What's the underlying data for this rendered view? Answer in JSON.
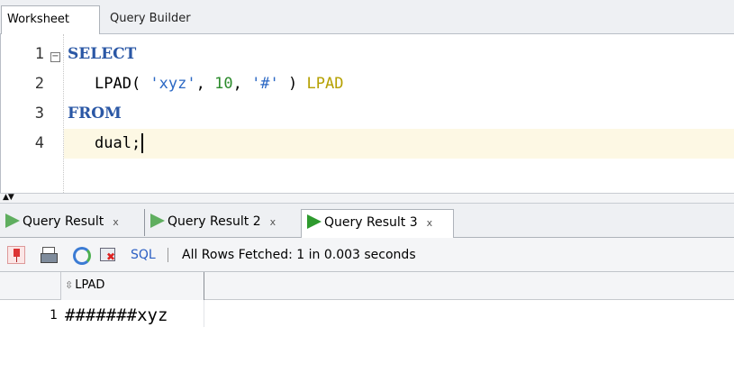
{
  "top_tabs": [
    {
      "label": "Worksheet",
      "active": true
    },
    {
      "label": "Query Builder",
      "active": false
    }
  ],
  "editor": {
    "lines": [
      {
        "number": "1",
        "tokens": {
          "kw": "SELECT"
        }
      },
      {
        "number": "2",
        "tokens": {
          "fn": "LPAD( ",
          "str1": "'xyz'",
          "comma1": ", ",
          "num": "10",
          "comma2": ", ",
          "str2": "'#'",
          "close": " ) ",
          "alias": "LPAD"
        }
      },
      {
        "number": "3",
        "tokens": {
          "kw": "FROM"
        }
      },
      {
        "number": "4",
        "tokens": {
          "text": "dual;"
        }
      }
    ],
    "fold_marker": "−"
  },
  "splitter": {
    "arrows": "▲▼"
  },
  "result_tabs": [
    {
      "label": "Query Result",
      "close": "x"
    },
    {
      "label": "Query Result 2",
      "close": "x"
    },
    {
      "label": "Query Result 3",
      "close": "x",
      "active": true
    }
  ],
  "toolbar": {
    "sql_label": "SQL",
    "separator": "|",
    "status": "All Rows Fetched: 1 in 0.003 seconds"
  },
  "grid": {
    "columns": [
      "LPAD"
    ],
    "rows": [
      {
        "num": "1",
        "values": [
          "#######xyz"
        ]
      }
    ]
  },
  "colors": {
    "keyword": "#2a57a5",
    "string": "#2b68c4",
    "number": "#2b8a2b",
    "alias": "#b5a000",
    "current_line": "#fdf8e4",
    "run_icon": "#2e9a2e"
  }
}
